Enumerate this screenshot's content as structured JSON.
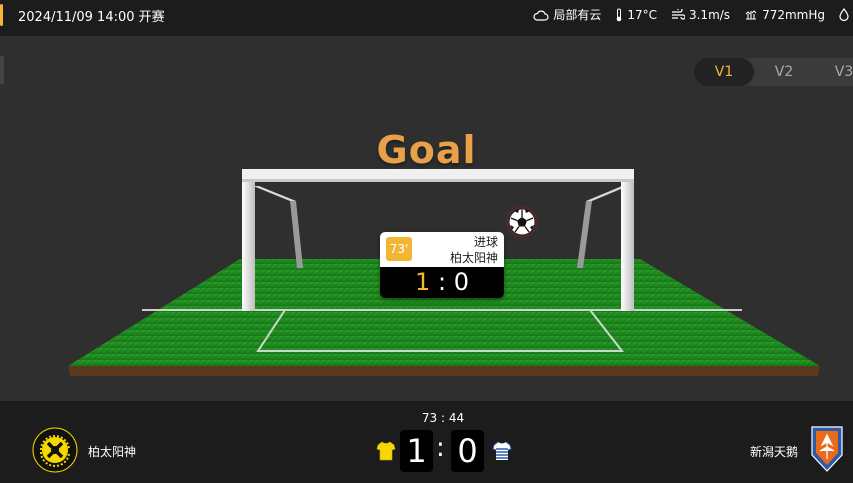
{
  "header": {
    "datetime": "2024/11/09 14:00",
    "status": "开赛",
    "weather": [
      {
        "icon": "cloud-icon",
        "label": "局部有云"
      },
      {
        "icon": "thermometer-icon",
        "label": "17°C"
      },
      {
        "icon": "wind-icon",
        "label": "3.1m/s"
      },
      {
        "icon": "pressure-icon",
        "label": "772mmHg"
      },
      {
        "icon": "humidity-icon",
        "label": ""
      }
    ]
  },
  "versions": [
    "V1",
    "V2",
    "V3"
  ],
  "active_version": "V1",
  "animation": {
    "goal_text": "Goal",
    "event_card": {
      "minute": "73'",
      "event": "进球",
      "team": "柏太阳神",
      "home_score": "1",
      "away_score": "0",
      "separator": ":"
    }
  },
  "match": {
    "clock": "73 : 44",
    "home": {
      "name": "柏太阳神",
      "score": "1",
      "kit_color": "#f5d800"
    },
    "away": {
      "name": "新潟天鹅",
      "score": "0",
      "kit_color": "#2a5caa"
    }
  },
  "colors": {
    "accent": "#f2b632",
    "goal_text": "#e8a14a",
    "grass": "#1a8a1a"
  }
}
